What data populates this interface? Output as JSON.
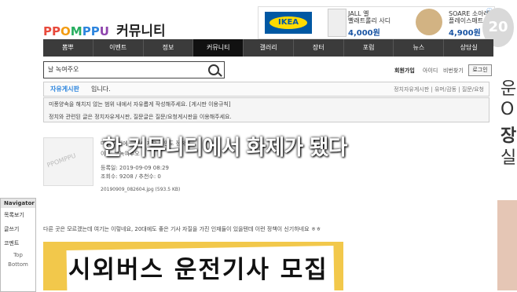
{
  "logo": {
    "p1": "PP",
    "p2": "O",
    "p3": "M",
    "p4": "PP",
    "p5": "U",
    "sub": "커뮤니티"
  },
  "ad": {
    "brand": "IKEA",
    "item1_title": "JALL 옐\n빨래트롤리 사디",
    "item1_price": "4,000원",
    "item2_title": "SOARE 소아레\n플레이스매트,원",
    "item2_price": "4,900원",
    "close": "ⓘ"
  },
  "watermark": "20",
  "nav": [
    "뽐뿌",
    "이벤트",
    "정보",
    "커뮤니티",
    "갤러리",
    "장터",
    "포럼",
    "뉴스",
    "상담실"
  ],
  "nav_active_index": 3,
  "search": {
    "value": "날 녹여주오"
  },
  "login": {
    "join": "회원가입",
    "id": "아이디",
    "pw": "비번찾기",
    "button": "로그인"
  },
  "board": {
    "name": "자유게시판",
    "suffix": "입니다.",
    "links": "정치자유게시판 | 유머/감동 | 질문/요청"
  },
  "notice": {
    "line1": "미풍양속을 해치지 않는 범위 내에서 자유롭게 작성해주세요. [게시판 이용규칙]",
    "line2": "정치와 관련된 글은 정치자유게시판, 질문글은 질문/요청게시판을 이용해주세요."
  },
  "post": {
    "thumb": "PPOMPPU",
    "line1": "마... 이번에... 게시 저고... 안도 정착",
    "line2": "이름: 날녹여주오",
    "date": "등록일: 2019-09-09 08:29",
    "stats": "조회수: 9208 / 추천수: 0",
    "file": "20190909_082604.jpg (593.5 KB)"
  },
  "caption": "한 커뮤니티에서 화제가 됐다",
  "body_text": "다른 곳은 모르겠는데 여기는 이렇네요, 20대에도 좋은 기사 자질을 가진 인재들이 있을텐데 이런 정책이 신기하네요 ㅎㅎ",
  "photo_text": "시외버스 운전기사 모집",
  "navigator": {
    "title": "Navigator",
    "items": [
      "목록보기",
      "글쓰기",
      "코멘트"
    ],
    "top": "Top",
    "bottom": "Bottom"
  },
  "sidead": {
    "k1": "운",
    "k2": "O",
    "k3": "장",
    "k4": "실"
  }
}
